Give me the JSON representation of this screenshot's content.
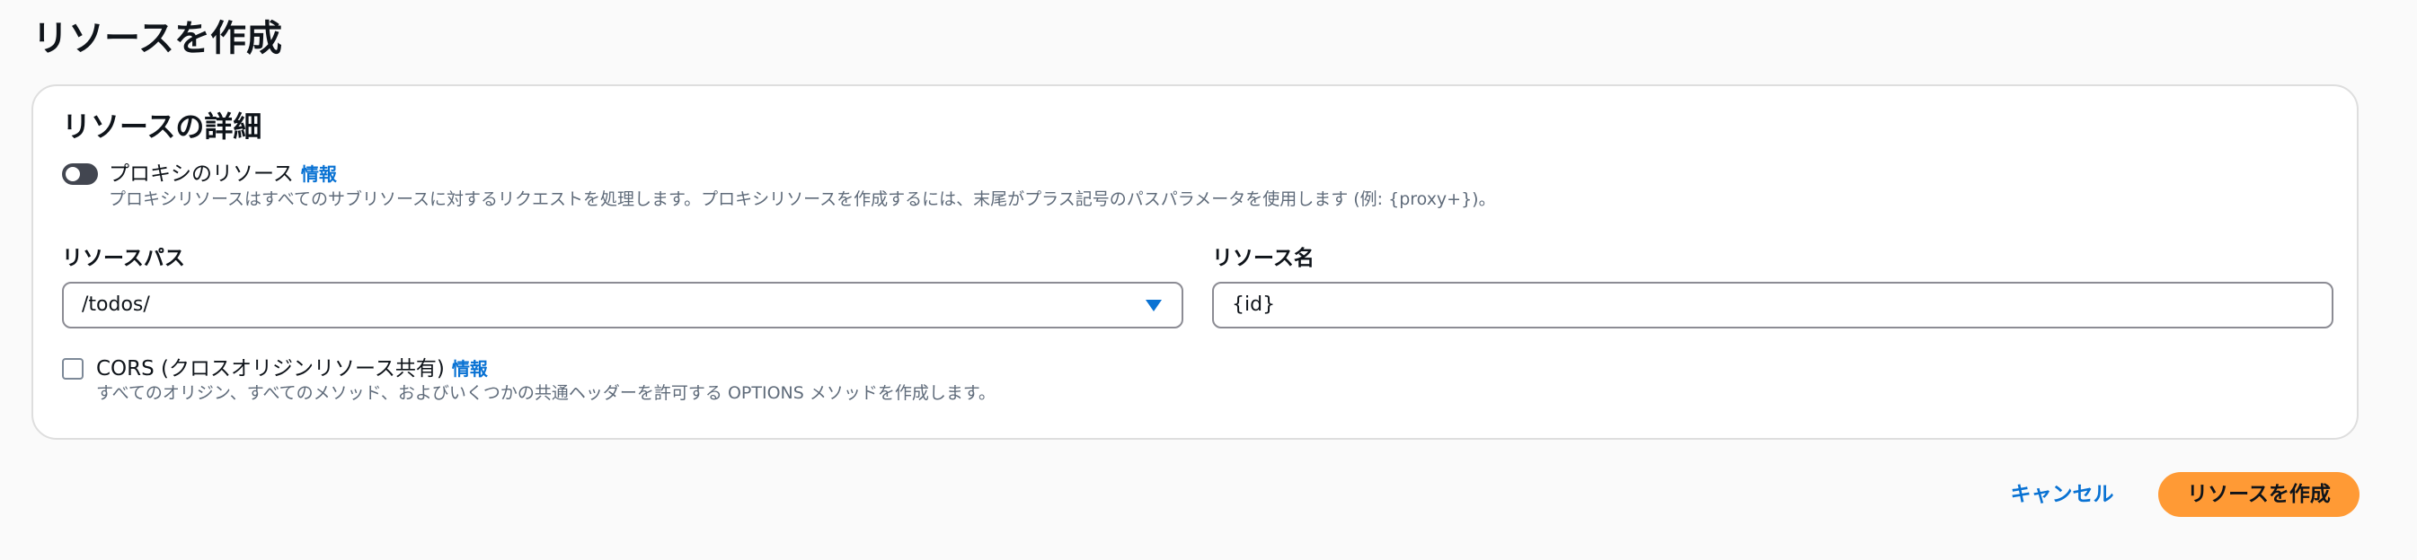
{
  "page": {
    "title": "リソースを作成"
  },
  "details": {
    "title": "リソースの詳細",
    "proxy": {
      "label": "プロキシのリソース",
      "info": "情報",
      "description": "プロキシリソースはすべてのサブリソースに対するリクエストを処理します。プロキシリソースを作成するには、末尾がプラス記号のパスパラメータを使用します (例: {proxy+})。",
      "enabled": false
    },
    "resource_path": {
      "label": "リソースパス",
      "value": "/todos/"
    },
    "resource_name": {
      "label": "リソース名",
      "value": "{id}"
    },
    "cors": {
      "label": "CORS (クロスオリジンリソース共有)",
      "info": "情報",
      "description": "すべてのオリジン、すべてのメソッド、およびいくつかの共通ヘッダーを許可する OPTIONS メソッドを作成します。",
      "checked": false
    }
  },
  "actions": {
    "cancel": "キャンセル",
    "create": "リソースを作成"
  },
  "colors": {
    "link": "#0972d3",
    "primary_button": "#ff9a35",
    "toggle_off": "#424650"
  }
}
